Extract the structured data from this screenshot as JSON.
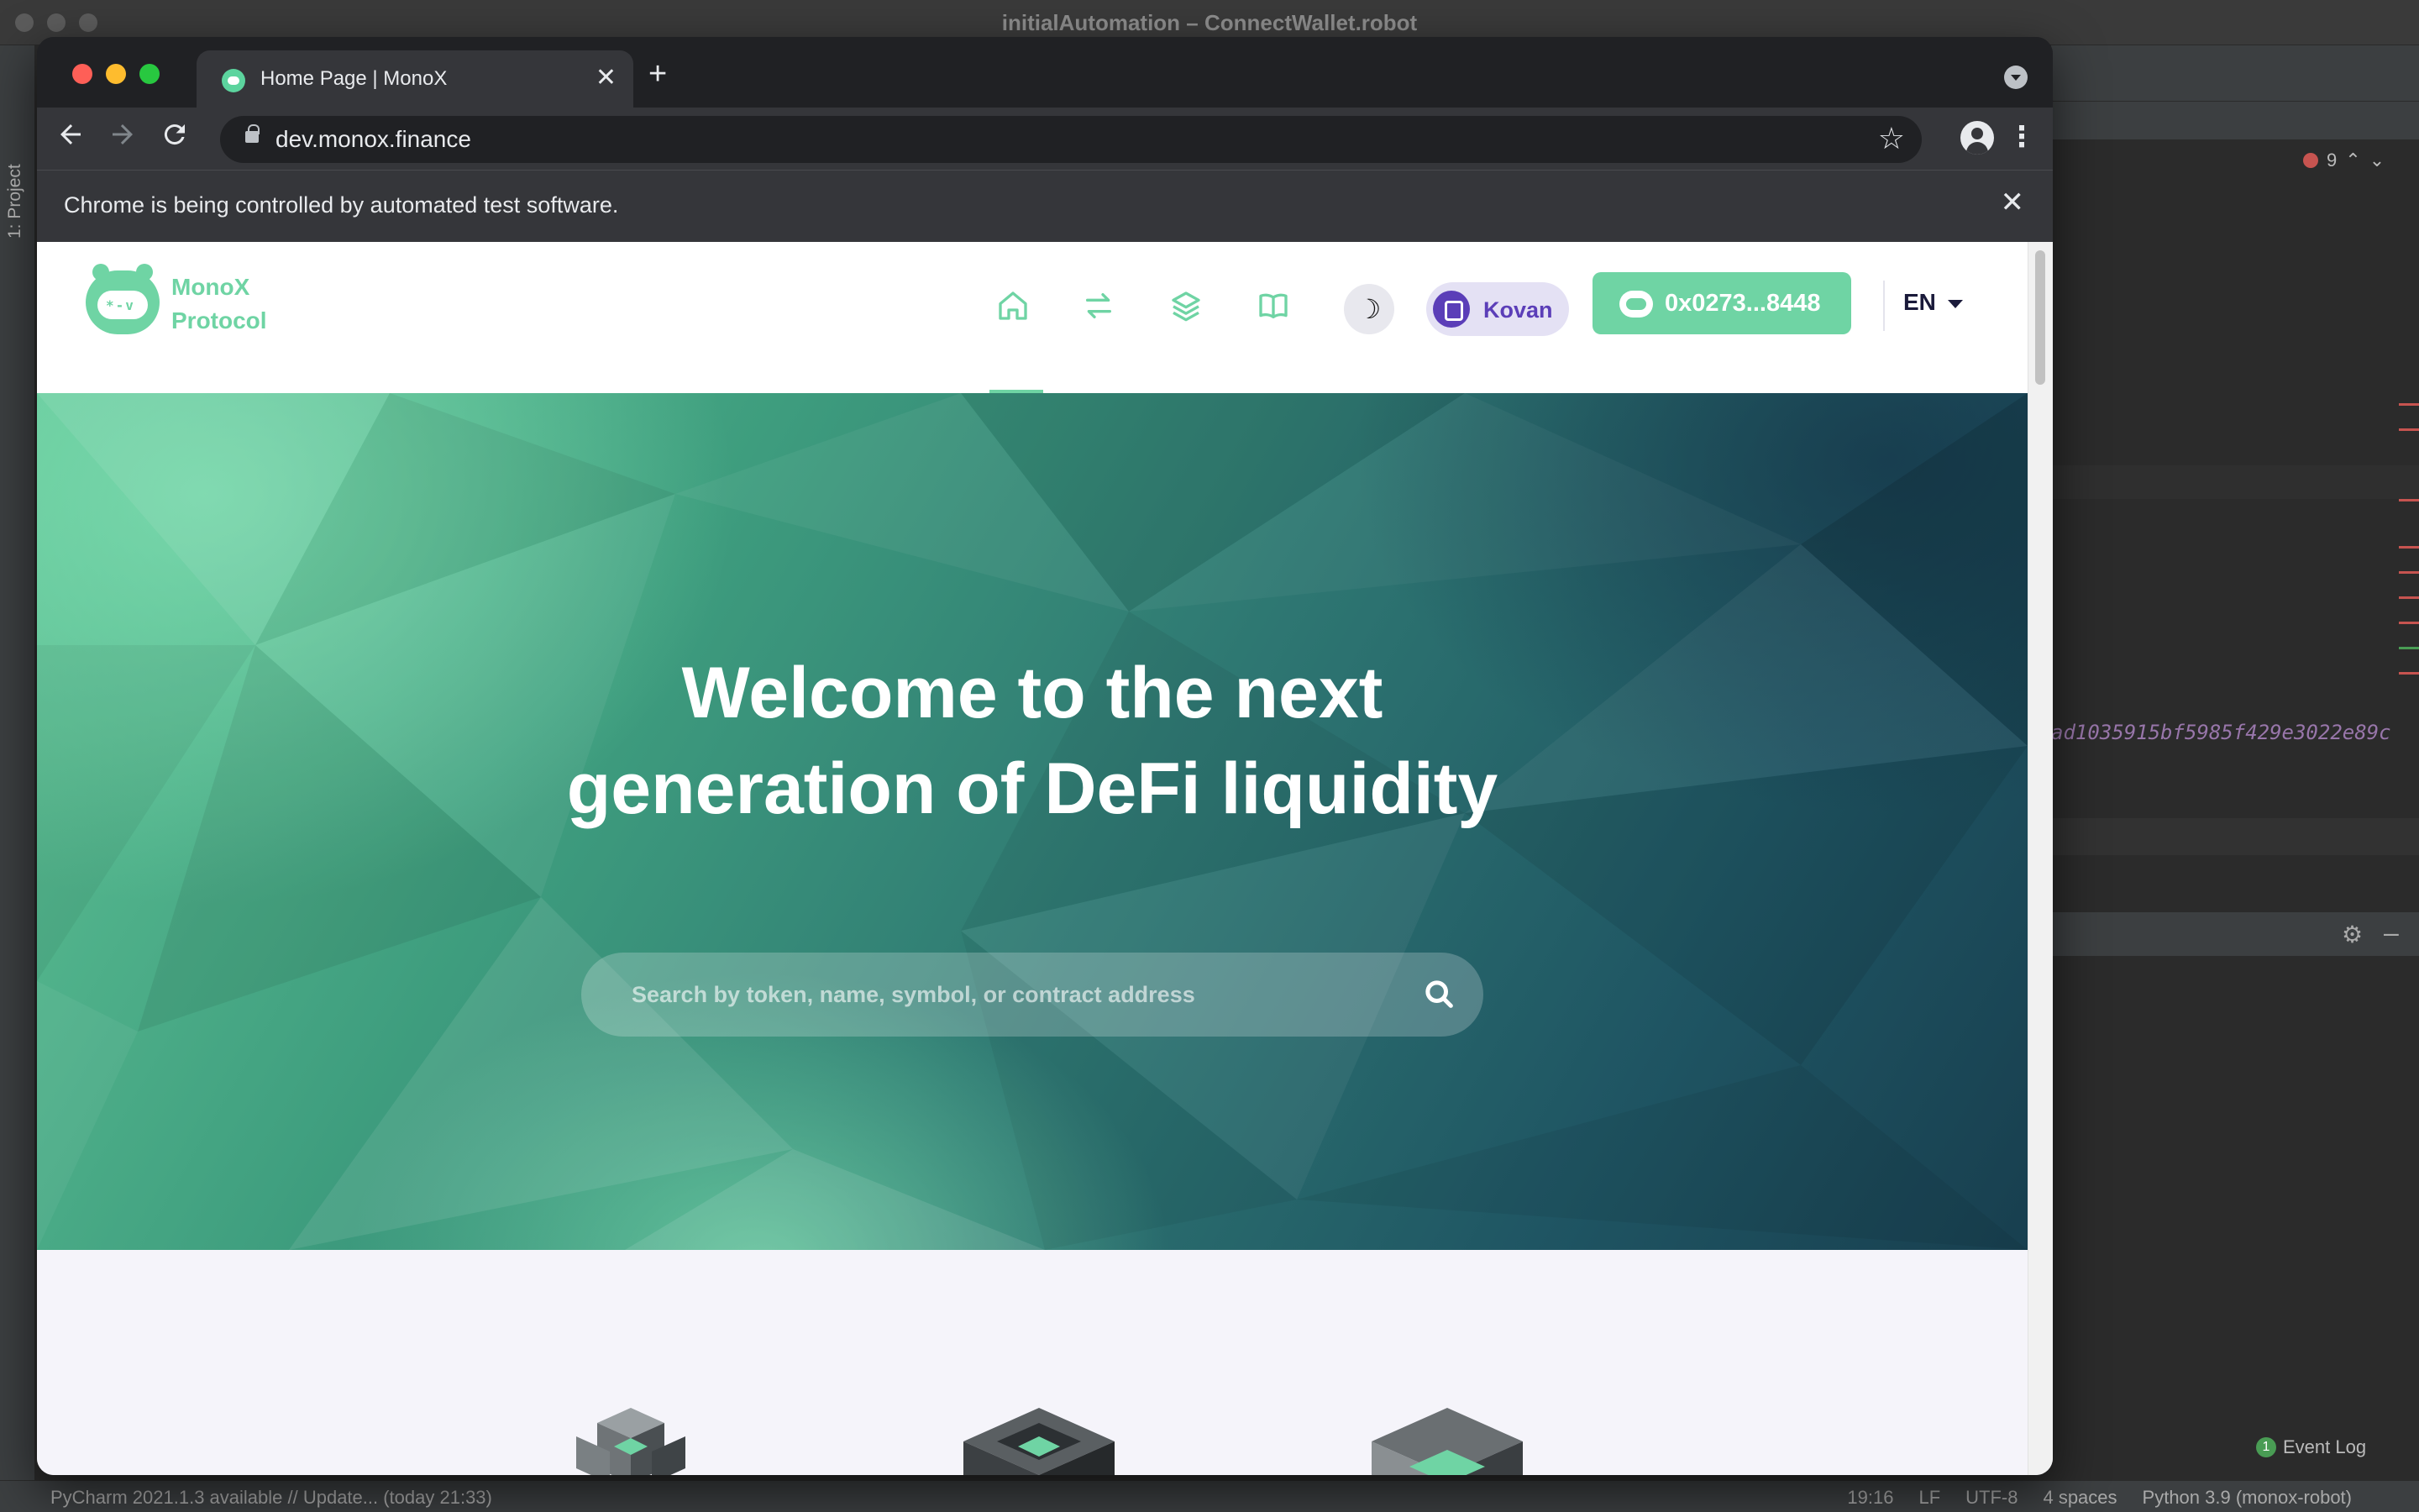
{
  "ide": {
    "window_title": "initialAutomation – ConnectWallet.robot",
    "project_tab": "1: Project",
    "error_count": "9",
    "code_fragment": "ad1035915bf5985f429e3022e89c",
    "status_left": "PyCharm 2021.1.3 available // Update... (today 21:33)",
    "status_right": [
      "19:16",
      "LF",
      "UTF-8",
      "4 spaces",
      "Python 3.9 (monox-robot)"
    ],
    "event_log": "Event Log",
    "event_badge": "1"
  },
  "browser": {
    "tab_title": "Home Page | MonoX",
    "tab_close": "✕",
    "new_tab": "+",
    "url": "dev.monox.finance",
    "infobar_text": "Chrome is being controlled by automated test software.",
    "infobar_close": "✕"
  },
  "site": {
    "logo_line1": "MonoX",
    "logo_line2": "Protocol",
    "logo_face": "*-v",
    "nav": [
      "home-icon",
      "swap-icon",
      "layers-icon",
      "book-icon"
    ],
    "theme_symbol": "☽",
    "network_label": "Kovan",
    "wallet_label": "0x0273...8448",
    "language": "EN",
    "hero_line1": "Welcome to the next",
    "hero_line2": "generation of DeFi liquidity",
    "search_placeholder": "Search by token, name, symbol, or contract address"
  },
  "colors": {
    "brand_green": "#6fd4a4",
    "network_purple": "#5b3eb8",
    "chrome_dark": "#202124",
    "chrome_toolbar": "#35363a"
  }
}
